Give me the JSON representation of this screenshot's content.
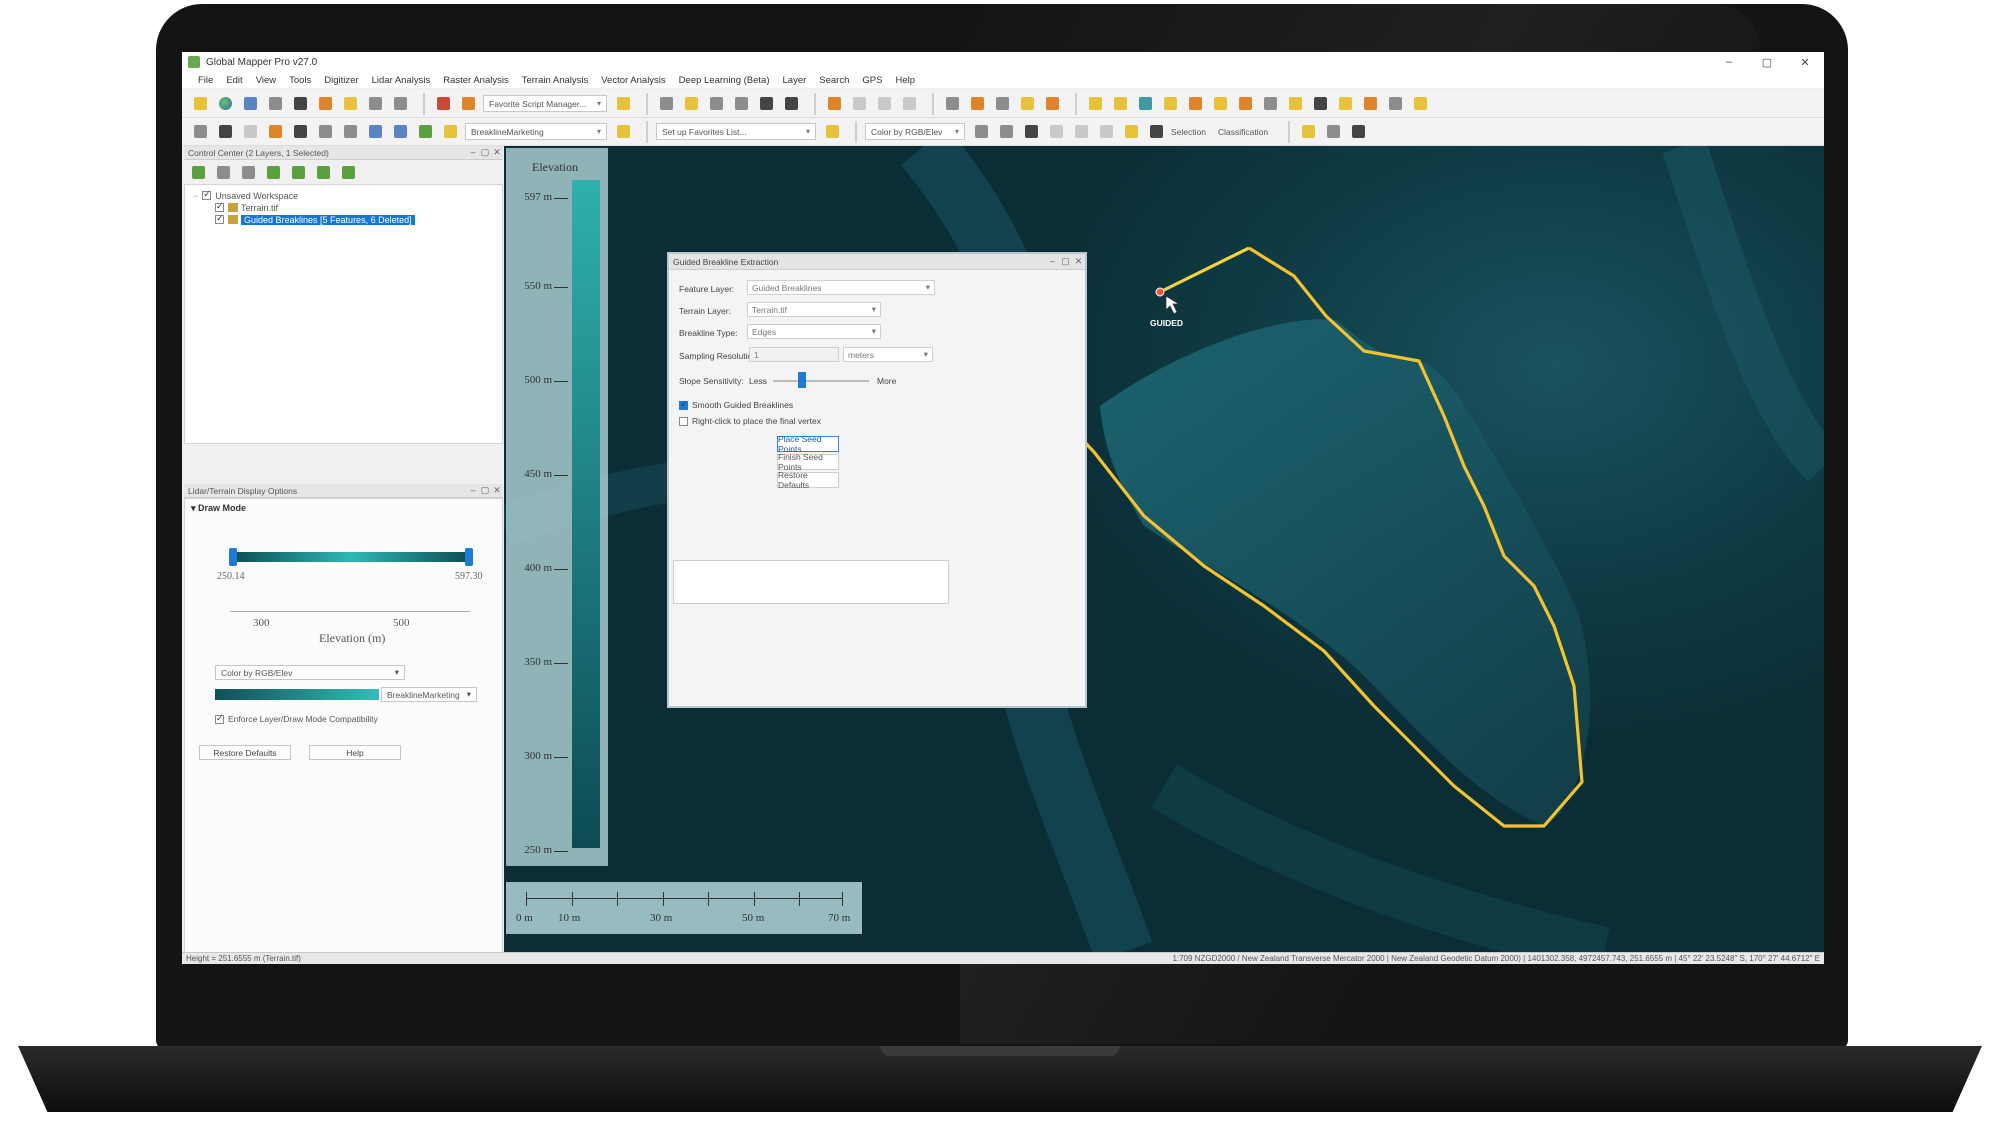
{
  "window": {
    "title": "Global Mapper Pro v27.0",
    "buttons": [
      "–",
      "▢",
      "✕"
    ]
  },
  "menu": [
    "File",
    "Edit",
    "View",
    "Tools",
    "Digitizer",
    "Lidar Analysis",
    "Raster Analysis",
    "Terrain Analysis",
    "Vector Analysis",
    "Deep Learning (Beta)",
    "Layer",
    "Search",
    "GPS",
    "Help"
  ],
  "toolbar": {
    "favorite_script": "Favorite Script Manager...",
    "breakline_combo": "BreaklineMarketing",
    "favorites_list": "Set up Favorites List...",
    "color_by": "Color by RGB/Elev",
    "selection": "Selection",
    "classification": "Classification"
  },
  "control_center": {
    "header": "Control Center (2 Layers, 1 Selected)",
    "workspace": "Unsaved Workspace",
    "layers": [
      "Terrain.tif",
      "Guided Breaklines [5 Features, 6 Deleted]"
    ]
  },
  "lidar_panel": {
    "header": "Lidar/Terrain Display Options",
    "draw_mode": "Draw Mode",
    "min_value": "250.14",
    "max_value": "597.30",
    "axis_ticks": [
      "300",
      "500"
    ],
    "axis_label": "Elevation (m)",
    "color_combo": "Color by RGB/Elev",
    "ramp_combo": "BreaklineMarketing",
    "compat_label": "Enforce Layer/Draw Mode Compatibility",
    "restore_btn": "Restore Defaults",
    "help_btn": "Help"
  },
  "elevation_legend": {
    "title": "Elevation",
    "labels": [
      "597 m",
      "550 m",
      "500 m",
      "450 m",
      "400 m",
      "350 m",
      "300 m",
      "250 m"
    ]
  },
  "scale_bar": {
    "labels": [
      "0 m",
      "10 m",
      "30 m",
      "50 m",
      "70 m"
    ]
  },
  "dialog": {
    "title": "Guided Breakline Extraction",
    "feature_layer_label": "Feature Layer:",
    "feature_layer_value": "Guided Breaklines",
    "terrain_layer_label": "Terrain Layer:",
    "terrain_layer_value": "Terrain.tif",
    "breakline_type_label": "Breakline Type:",
    "breakline_type_value": "Edges",
    "sampling_label": "Sampling Resolution:",
    "sampling_value": "1",
    "sampling_unit": "meters",
    "slope_label": "Slope Sensitivity:",
    "slope_less": "Less",
    "slope_more": "More",
    "slope_value": 0.3,
    "smooth_label": "Smooth Guided Breaklines",
    "smooth_checked": true,
    "rightclick_label": "Right-click to place the final vertex",
    "rightclick_checked": false,
    "place_btn": "Place Seed Points",
    "finish_btn": "Finish Seed Points",
    "restore_btn": "Restore Defaults"
  },
  "map": {
    "cursor_label": "GUIDED",
    "line_color": "#f2c230"
  },
  "status": {
    "left": "Height = 251.6555 m (Terrain.tif)",
    "right": "1:709  NZGD2000 / New Zealand Transverse Mercator 2000 | New Zealand Geodetic Datum 2000) | 1401302.358, 4972457.743, 251.6555 m |  45° 22' 23.5248\" S, 170° 27' 44.6712\" E"
  }
}
